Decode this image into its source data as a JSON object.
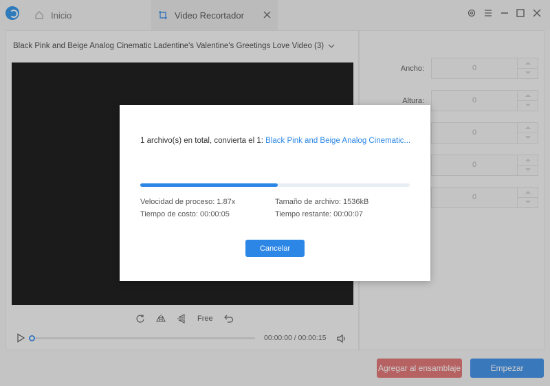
{
  "tabs": {
    "home_label": "Inicio",
    "active_label": "Video Recortador"
  },
  "video": {
    "file_name": "Black Pink and Beige Analog Cinematic Ladentine's Valentine's Greetings Love Video (3)",
    "time": "00:00:00 / 00:00:15",
    "playback_progress": 0
  },
  "tools": {
    "free_label": "Free"
  },
  "fields": [
    {
      "label": "Ancho:",
      "value": "0"
    },
    {
      "label": "Altura:",
      "value": "0"
    },
    {
      "label": "",
      "value": "0"
    },
    {
      "label": "",
      "value": "0"
    },
    {
      "label": "",
      "value": "0"
    }
  ],
  "buttons": {
    "add": "Agregar al ensamblaje",
    "start": "Empezar"
  },
  "dialog": {
    "message_prefix": "1 archivo(s) en total, convierta el 1: ",
    "message_file": "Black Pink and Beige Analog Cinematic...",
    "progress": 0.51,
    "speed": "Velocidad de proceso: 1.87x",
    "size": "Tamaño de archivo: 1536kB",
    "cost_time": "Tiempo de costo: 00:00:05",
    "remaining": "Tiempo restante: 00:00:07",
    "cancel": "Cancelar"
  },
  "colors": {
    "accent": "#2b86e6",
    "danger": "#e06666"
  }
}
